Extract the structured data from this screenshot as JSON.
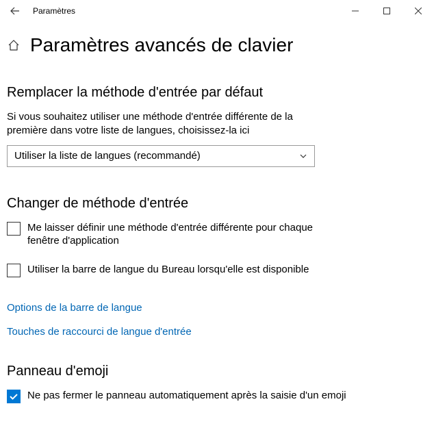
{
  "titlebar": {
    "app_name": "Paramètres"
  },
  "page": {
    "title": "Paramètres avancés de clavier"
  },
  "section_override": {
    "title": "Remplacer la méthode d'entrée par défaut",
    "description": "Si vous souhaitez utiliser une méthode d'entrée différente de la première dans votre liste de langues, choisissez-la ici",
    "dropdown_value": "Utiliser la liste de langues (recommandé)"
  },
  "section_switch": {
    "title": "Changer de méthode d'entrée",
    "checkbox_per_window": {
      "label": "Me laisser définir une méthode d'entrée différente pour chaque fenêtre d'application",
      "checked": false
    },
    "checkbox_desktop_bar": {
      "label": "Utiliser la barre de langue du Bureau lorsqu'elle est disponible",
      "checked": false
    },
    "link_langbar": "Options de la barre de langue",
    "link_hotkeys": "Touches de raccourci de langue d'entrée"
  },
  "section_emoji": {
    "title": "Panneau d'emoji",
    "checkbox_noclose": {
      "label": "Ne pas fermer le panneau automatiquement après la saisie d'un emoji",
      "checked": true
    }
  },
  "colors": {
    "accent": "#0078d4",
    "link": "#0066b4"
  }
}
